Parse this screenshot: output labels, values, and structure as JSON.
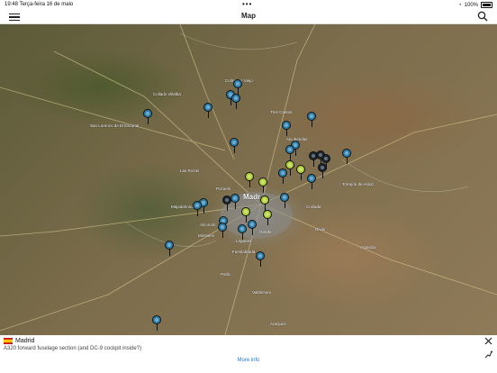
{
  "status_bar": {
    "time": "19:48",
    "date": "Terça-feira 16 de maio",
    "dots": "•••",
    "battery": "100%"
  },
  "nav": {
    "title": "Map",
    "menu_icon": "hamburger-icon",
    "search_icon": "search-icon"
  },
  "map": {
    "city_label": "Madr",
    "labels": [
      "San Lorenzo de El Escorial",
      "Alcobendas",
      "Torrejón de Ardoz",
      "Pozuelo",
      "Alcorcón",
      "Móstoles",
      "Getafe",
      "Fuenlabrada",
      "Leganés",
      "Collado Villalba",
      "Las Rozas",
      "Majadahonda",
      "Coslada",
      "Rivas",
      "Arganda",
      "Parla",
      "Valdemoro",
      "Colmenar Viejo",
      "Tres Cantos",
      "Aranjuez"
    ],
    "pin_colors": {
      "blue": "#2b7fae",
      "green": "#b2d235",
      "dark": "#1a2630"
    }
  },
  "panel": {
    "flag_icon": "spain-flag-icon",
    "place": "Madrid",
    "description": "A320 forward fuselage section (and DC-9 cockpit inside?)",
    "more_info": "More info",
    "close_icon": "close-icon",
    "route_icon": "route-icon"
  }
}
